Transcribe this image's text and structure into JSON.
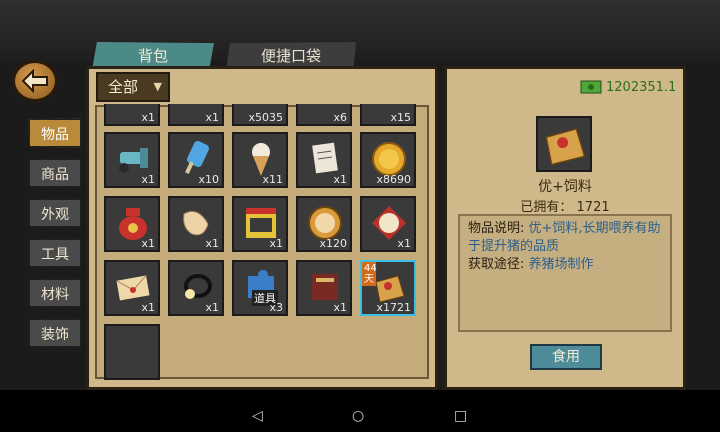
{
  "tabs": {
    "bag": "背包",
    "quick": "便捷口袋"
  },
  "filter": {
    "selected": "全部"
  },
  "categories": [
    "物品",
    "商品",
    "外观",
    "工具",
    "材料",
    "装饰"
  ],
  "money": "1202351.1",
  "grid": {
    "row0": [
      "x1",
      "x1",
      "x5035",
      "x6",
      "x15"
    ],
    "row1": [
      "x1",
      "x10",
      "x11",
      "x1",
      "x8690"
    ],
    "row2": [
      "x1",
      "x1",
      "x1",
      "x120",
      "x1"
    ],
    "row3": [
      "x1",
      "x1",
      "x3",
      "x1",
      "x1721"
    ],
    "puzzle_label": "道具",
    "tag_44": "44",
    "tag_tian": "天"
  },
  "detail": {
    "name": "优+饲料",
    "owned": "已拥有：  1721",
    "desc_label": "物品说明:",
    "desc_value": "优+饲料,长期喂养有助于提升猪的品质",
    "source_label": "获取途径:",
    "source_value": "养猪场制作",
    "use_button": "食用"
  },
  "colors": {
    "accent": "#4c8a88",
    "selected_border": "#3cc0e6",
    "money": "#2f6e1e"
  }
}
